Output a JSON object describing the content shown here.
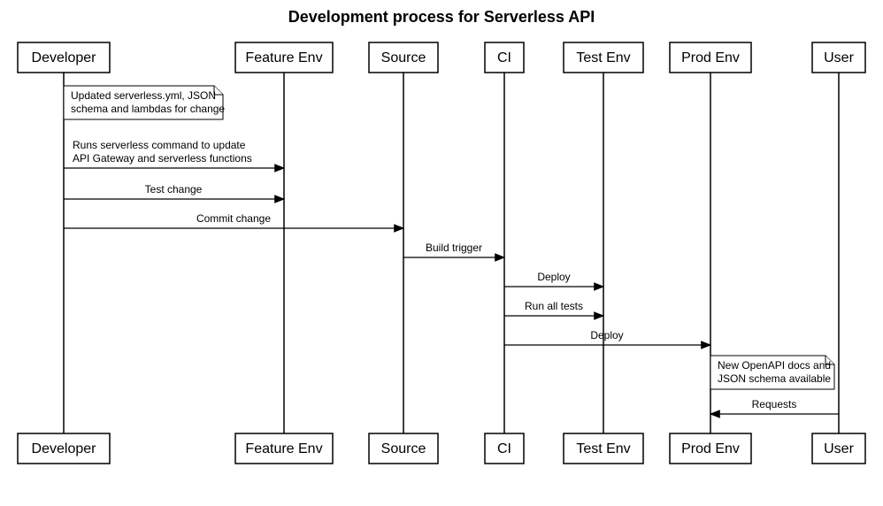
{
  "title": "Development process for Serverless API",
  "participants": {
    "developer": "Developer",
    "featureEnv": "Feature Env",
    "source": "Source",
    "ci": "CI",
    "testEnv": "Test Env",
    "prodEnv": "Prod Env",
    "user": "User"
  },
  "notes": {
    "developerNote": {
      "line1": "Updated serverless.yml, JSON",
      "line2": "schema and lambdas for change"
    },
    "prodNote": {
      "line1": "New OpenAPI docs and",
      "line2": "JSON schema available"
    }
  },
  "messages": {
    "runServerless1": "Runs serverless command to update",
    "runServerless2": "API Gateway and serverless functions",
    "testChange": "Test change",
    "commitChange": "Commit change",
    "buildTrigger": "Build trigger",
    "deploy1": "Deploy",
    "runAllTests": "Run all tests",
    "deploy2": "Deploy",
    "requests": "Requests"
  },
  "chart_data": {
    "type": "sequence-diagram",
    "title": "Development process for Serverless API",
    "participants": [
      "Developer",
      "Feature Env",
      "Source",
      "CI",
      "Test Env",
      "Prod Env",
      "User"
    ],
    "events": [
      {
        "kind": "note",
        "on": "Developer",
        "text": "Updated serverless.yml, JSON schema and lambdas for change"
      },
      {
        "kind": "message",
        "from": "Developer",
        "to": "Feature Env",
        "text": "Runs serverless command to update API Gateway and serverless functions"
      },
      {
        "kind": "message",
        "from": "Developer",
        "to": "Feature Env",
        "text": "Test change"
      },
      {
        "kind": "message",
        "from": "Developer",
        "to": "Source",
        "text": "Commit change"
      },
      {
        "kind": "message",
        "from": "Source",
        "to": "CI",
        "text": "Build trigger"
      },
      {
        "kind": "message",
        "from": "CI",
        "to": "Test Env",
        "text": "Deploy"
      },
      {
        "kind": "message",
        "from": "CI",
        "to": "Test Env",
        "text": "Run all tests"
      },
      {
        "kind": "message",
        "from": "CI",
        "to": "Prod Env",
        "text": "Deploy"
      },
      {
        "kind": "note",
        "on": "Prod Env",
        "text": "New OpenAPI docs and JSON schema available"
      },
      {
        "kind": "message",
        "from": "User",
        "to": "Prod Env",
        "text": "Requests"
      }
    ]
  }
}
